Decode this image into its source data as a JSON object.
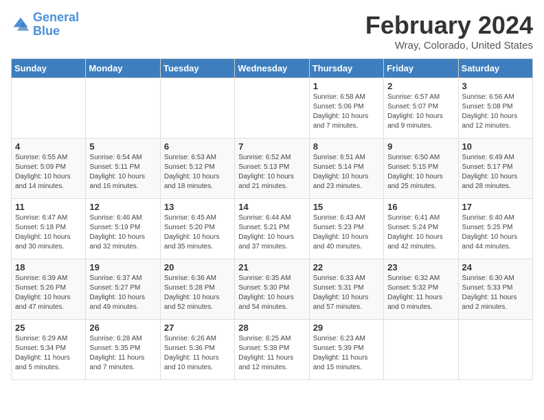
{
  "logo": {
    "line1": "General",
    "line2": "Blue"
  },
  "title": "February 2024",
  "subtitle": "Wray, Colorado, United States",
  "weekdays": [
    "Sunday",
    "Monday",
    "Tuesday",
    "Wednesday",
    "Thursday",
    "Friday",
    "Saturday"
  ],
  "weeks": [
    [
      {
        "day": "",
        "info": ""
      },
      {
        "day": "",
        "info": ""
      },
      {
        "day": "",
        "info": ""
      },
      {
        "day": "",
        "info": ""
      },
      {
        "day": "1",
        "info": "Sunrise: 6:58 AM\nSunset: 5:06 PM\nDaylight: 10 hours\nand 7 minutes."
      },
      {
        "day": "2",
        "info": "Sunrise: 6:57 AM\nSunset: 5:07 PM\nDaylight: 10 hours\nand 9 minutes."
      },
      {
        "day": "3",
        "info": "Sunrise: 6:56 AM\nSunset: 5:08 PM\nDaylight: 10 hours\nand 12 minutes."
      }
    ],
    [
      {
        "day": "4",
        "info": "Sunrise: 6:55 AM\nSunset: 5:09 PM\nDaylight: 10 hours\nand 14 minutes."
      },
      {
        "day": "5",
        "info": "Sunrise: 6:54 AM\nSunset: 5:11 PM\nDaylight: 10 hours\nand 16 minutes."
      },
      {
        "day": "6",
        "info": "Sunrise: 6:53 AM\nSunset: 5:12 PM\nDaylight: 10 hours\nand 18 minutes."
      },
      {
        "day": "7",
        "info": "Sunrise: 6:52 AM\nSunset: 5:13 PM\nDaylight: 10 hours\nand 21 minutes."
      },
      {
        "day": "8",
        "info": "Sunrise: 6:51 AM\nSunset: 5:14 PM\nDaylight: 10 hours\nand 23 minutes."
      },
      {
        "day": "9",
        "info": "Sunrise: 6:50 AM\nSunset: 5:15 PM\nDaylight: 10 hours\nand 25 minutes."
      },
      {
        "day": "10",
        "info": "Sunrise: 6:49 AM\nSunset: 5:17 PM\nDaylight: 10 hours\nand 28 minutes."
      }
    ],
    [
      {
        "day": "11",
        "info": "Sunrise: 6:47 AM\nSunset: 5:18 PM\nDaylight: 10 hours\nand 30 minutes."
      },
      {
        "day": "12",
        "info": "Sunrise: 6:46 AM\nSunset: 5:19 PM\nDaylight: 10 hours\nand 32 minutes."
      },
      {
        "day": "13",
        "info": "Sunrise: 6:45 AM\nSunset: 5:20 PM\nDaylight: 10 hours\nand 35 minutes."
      },
      {
        "day": "14",
        "info": "Sunrise: 6:44 AM\nSunset: 5:21 PM\nDaylight: 10 hours\nand 37 minutes."
      },
      {
        "day": "15",
        "info": "Sunrise: 6:43 AM\nSunset: 5:23 PM\nDaylight: 10 hours\nand 40 minutes."
      },
      {
        "day": "16",
        "info": "Sunrise: 6:41 AM\nSunset: 5:24 PM\nDaylight: 10 hours\nand 42 minutes."
      },
      {
        "day": "17",
        "info": "Sunrise: 6:40 AM\nSunset: 5:25 PM\nDaylight: 10 hours\nand 44 minutes."
      }
    ],
    [
      {
        "day": "18",
        "info": "Sunrise: 6:39 AM\nSunset: 5:26 PM\nDaylight: 10 hours\nand 47 minutes."
      },
      {
        "day": "19",
        "info": "Sunrise: 6:37 AM\nSunset: 5:27 PM\nDaylight: 10 hours\nand 49 minutes."
      },
      {
        "day": "20",
        "info": "Sunrise: 6:36 AM\nSunset: 5:28 PM\nDaylight: 10 hours\nand 52 minutes."
      },
      {
        "day": "21",
        "info": "Sunrise: 6:35 AM\nSunset: 5:30 PM\nDaylight: 10 hours\nand 54 minutes."
      },
      {
        "day": "22",
        "info": "Sunrise: 6:33 AM\nSunset: 5:31 PM\nDaylight: 10 hours\nand 57 minutes."
      },
      {
        "day": "23",
        "info": "Sunrise: 6:32 AM\nSunset: 5:32 PM\nDaylight: 11 hours\nand 0 minutes."
      },
      {
        "day": "24",
        "info": "Sunrise: 6:30 AM\nSunset: 5:33 PM\nDaylight: 11 hours\nand 2 minutes."
      }
    ],
    [
      {
        "day": "25",
        "info": "Sunrise: 6:29 AM\nSunset: 5:34 PM\nDaylight: 11 hours\nand 5 minutes."
      },
      {
        "day": "26",
        "info": "Sunrise: 6:28 AM\nSunset: 5:35 PM\nDaylight: 11 hours\nand 7 minutes."
      },
      {
        "day": "27",
        "info": "Sunrise: 6:26 AM\nSunset: 5:36 PM\nDaylight: 11 hours\nand 10 minutes."
      },
      {
        "day": "28",
        "info": "Sunrise: 6:25 AM\nSunset: 5:38 PM\nDaylight: 11 hours\nand 12 minutes."
      },
      {
        "day": "29",
        "info": "Sunrise: 6:23 AM\nSunset: 5:39 PM\nDaylight: 11 hours\nand 15 minutes."
      },
      {
        "day": "",
        "info": ""
      },
      {
        "day": "",
        "info": ""
      }
    ]
  ]
}
